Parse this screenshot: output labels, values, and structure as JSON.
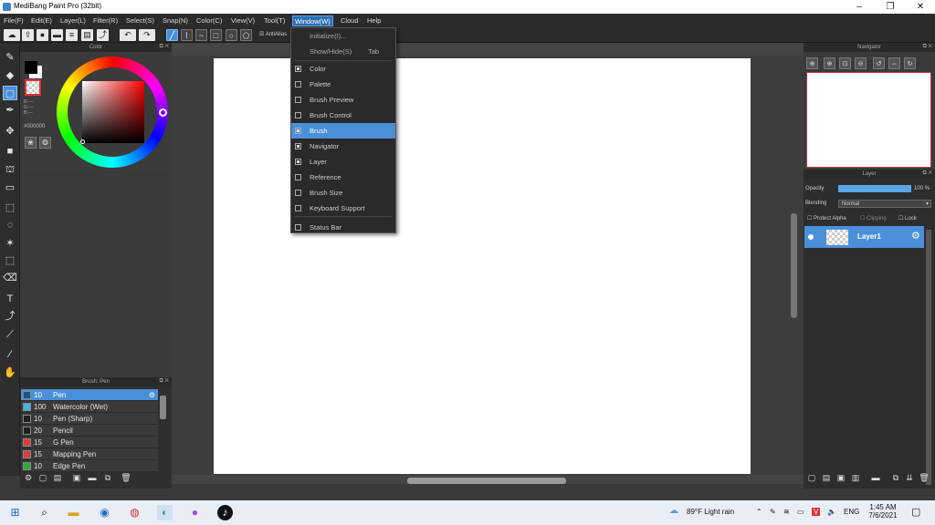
{
  "window": {
    "title": "MediBang Paint Pro (32bit)",
    "minimize": "–",
    "maximize": "❐",
    "close": "✕"
  },
  "menubar": [
    "File(F)",
    "Edit(E)",
    "Layer(L)",
    "Filter(R)",
    "Select(S)",
    "Snap(N)",
    "Color(C)",
    "View(V)",
    "Tool(T)",
    "Window(W)",
    "Cloud",
    "Help"
  ],
  "toolbar": {
    "antialias_label": "AntiAlias"
  },
  "window_menu": {
    "initialize": "Initialize(I)...",
    "show_hide": "Show/Hide(S)",
    "show_hide_key": "Tab",
    "items": [
      {
        "label": "Color",
        "checked": true
      },
      {
        "label": "Palette",
        "checked": false
      },
      {
        "label": "Brush Preview",
        "checked": false
      },
      {
        "label": "Brush Control",
        "checked": false
      },
      {
        "label": "Brush",
        "checked": true,
        "highlighted": true
      },
      {
        "label": "Navigator",
        "checked": true
      },
      {
        "label": "Layer",
        "checked": true
      },
      {
        "label": "Reference",
        "checked": false
      },
      {
        "label": "Brush Size",
        "checked": false
      },
      {
        "label": "Keyboard Support",
        "checked": false
      },
      {
        "label": "Status Bar",
        "checked": false
      }
    ]
  },
  "color_panel": {
    "title": "Color",
    "rgb_r": "R:---",
    "rgb_g": "G:---",
    "rgb_b": "B:---",
    "hex": "#000000",
    "foreground": "#000000",
    "background": "#ffffff"
  },
  "brush_panel": {
    "title": "Brush: Pen",
    "brushes": [
      {
        "size": "10",
        "name": "Pen",
        "color": "#1a4f8a",
        "selected": true
      },
      {
        "size": "100",
        "name": "Watercolor (Wet)",
        "color": "#45b5e0",
        "selected": false
      },
      {
        "size": "10",
        "name": "Pen (Sharp)",
        "color": "#222222",
        "selected": false
      },
      {
        "size": "20",
        "name": "Pencil",
        "color": "#222222",
        "selected": false
      },
      {
        "size": "15",
        "name": "G Pen",
        "color": "#e03a3a",
        "selected": false
      },
      {
        "size": "15",
        "name": "Mapping Pen",
        "color": "#e03a3a",
        "selected": false
      },
      {
        "size": "10",
        "name": "Edge Pen",
        "color": "#2eaa3a",
        "selected": false
      }
    ]
  },
  "navigator_panel": {
    "title": "Navigator"
  },
  "layer_panel": {
    "title": "Layer",
    "opacity_label": "Opacity",
    "opacity_value": "100 %",
    "opacity": 1.0,
    "blending_label": "Blending",
    "blending_value": "Normal",
    "protect_alpha": "Protect Alpha",
    "clipping": "Clipping",
    "lock": "Lock",
    "layers": [
      {
        "name": "Layer1"
      }
    ]
  },
  "taskbar": {
    "weather": "89°F  Light rain",
    "lang": "ENG",
    "time": "1:45 AM",
    "date": "7/6/2021"
  }
}
